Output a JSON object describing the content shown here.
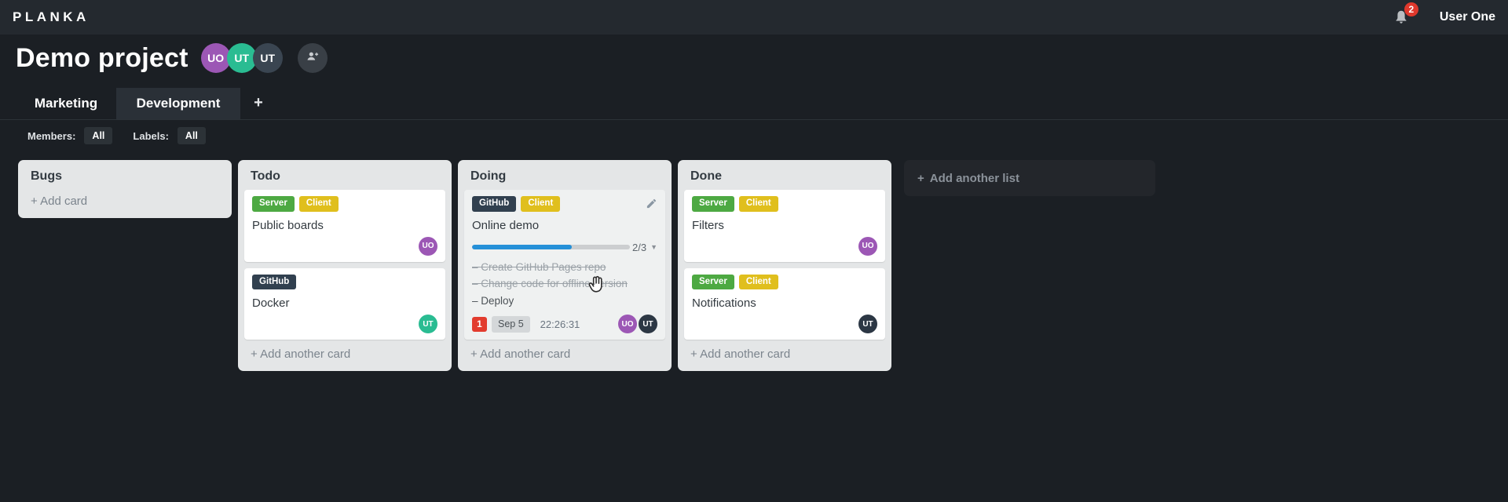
{
  "topbar": {
    "logo": "PLANKA",
    "notification_count": "2",
    "user_name": "User One"
  },
  "colors": {
    "notification_badge": "#df382c",
    "card_notification_badge": "#e23c2e",
    "progress_bar": "#2590d8"
  },
  "header": {
    "title": "Demo project",
    "members": [
      {
        "initials": "UO",
        "color": "#9c57b5"
      },
      {
        "initials": "UT",
        "color": "#2abc92"
      },
      {
        "initials": "UT",
        "color": "#3a4551"
      }
    ]
  },
  "tabs": {
    "items": [
      {
        "label": "Marketing",
        "active": false
      },
      {
        "label": "Development",
        "active": true
      }
    ],
    "add_button": "+"
  },
  "filters": {
    "members_label": "Members:",
    "members_value": "All",
    "labels_label": "Labels:",
    "labels_value": "All"
  },
  "board": {
    "add_list_label": "Add another list",
    "lists": [
      {
        "title": "Bugs",
        "add_label": "Add card",
        "cards": []
      },
      {
        "title": "Todo",
        "add_label": "Add another card",
        "cards": [
          {
            "labels": [
              {
                "text": "Server",
                "color": "#4da942"
              },
              {
                "text": "Client",
                "color": "#e0bf1d"
              }
            ],
            "title": "Public boards",
            "members": [
              {
                "initials": "UO",
                "color": "#9c57b5"
              }
            ]
          },
          {
            "labels": [
              {
                "text": "GitHub",
                "color": "#31404f"
              }
            ],
            "title": "Docker",
            "members": [
              {
                "initials": "UT",
                "color": "#2abc92"
              }
            ]
          }
        ]
      },
      {
        "title": "Doing",
        "add_label": "Add another card",
        "cards": [
          {
            "labels": [
              {
                "text": "GitHub",
                "color": "#31404f"
              },
              {
                "text": "Client",
                "color": "#e0bf1d"
              }
            ],
            "title": "Online demo",
            "editable": true,
            "hovered": true,
            "progress": {
              "label": "2/3",
              "percent": 63
            },
            "tasks": [
              {
                "text": "Create GitHub Pages repo",
                "done": true
              },
              {
                "text": "Change code for offline version",
                "done": true
              },
              {
                "text": "Deploy",
                "done": false
              }
            ],
            "notification_count": "1",
            "due_date": "Sep 5",
            "timer": "22:26:31",
            "members": [
              {
                "initials": "UO",
                "color": "#9c57b5"
              },
              {
                "initials": "UT",
                "color": "#2c3744"
              }
            ]
          }
        ]
      },
      {
        "title": "Done",
        "add_label": "Add another card",
        "cards": [
          {
            "labels": [
              {
                "text": "Server",
                "color": "#4da942"
              },
              {
                "text": "Client",
                "color": "#e0bf1d"
              }
            ],
            "title": "Filters",
            "members": [
              {
                "initials": "UO",
                "color": "#9c57b5"
              }
            ]
          },
          {
            "labels": [
              {
                "text": "Server",
                "color": "#4da942"
              },
              {
                "text": "Client",
                "color": "#e0bf1d"
              }
            ],
            "title": "Notifications",
            "members": [
              {
                "initials": "UT",
                "color": "#2c3744"
              }
            ]
          }
        ]
      }
    ]
  }
}
